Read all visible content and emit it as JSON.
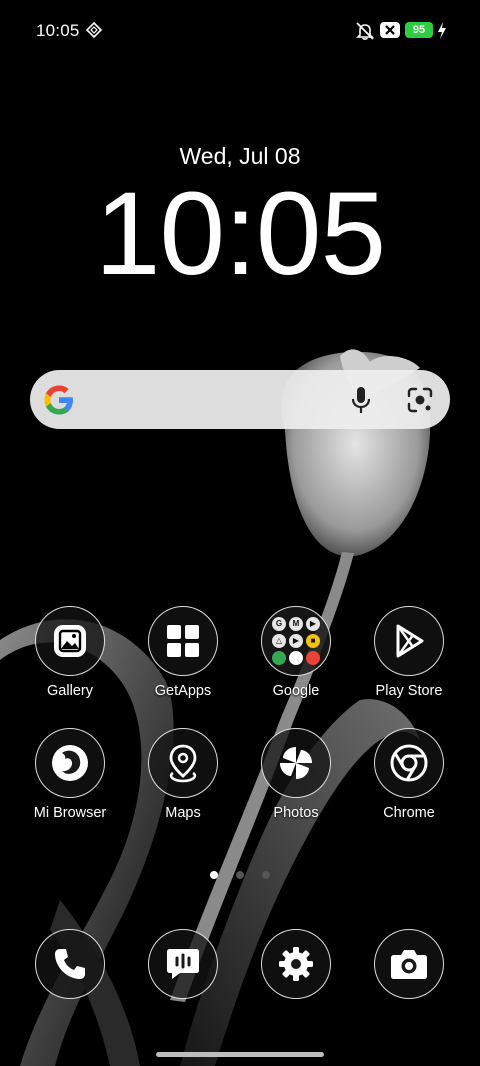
{
  "status_bar": {
    "time": "10:05",
    "battery": "95",
    "icons": [
      "network-diamond-icon",
      "mute-icon",
      "x-notification-icon",
      "charging-bolt-icon"
    ],
    "battery_color": "#2ecc40"
  },
  "clock": {
    "date": "Wed, Jul 08",
    "time": "10:05"
  },
  "search": {
    "icons": [
      "google-logo-icon",
      "mic-icon",
      "lens-camera-icon"
    ]
  },
  "apps": [
    {
      "label": "Gallery",
      "icon": "gallery-icon"
    },
    {
      "label": "GetApps",
      "icon": "getapps-grid-icon"
    },
    {
      "label": "Google",
      "icon": "google-folder-icon"
    },
    {
      "label": "Play Store",
      "icon": "play-store-icon"
    },
    {
      "label": "Mi Browser",
      "icon": "mi-browser-icon"
    },
    {
      "label": "Maps",
      "icon": "maps-pin-icon"
    },
    {
      "label": "Photos",
      "icon": "photos-pinwheel-icon"
    },
    {
      "label": "Chrome",
      "icon": "chrome-icon"
    }
  ],
  "google_folder": {
    "mini_icons": [
      "G",
      "M",
      "▶",
      "△",
      "▶",
      "■",
      "●",
      "●",
      "●"
    ]
  },
  "dock": [
    {
      "icon": "phone-icon"
    },
    {
      "icon": "messages-icon"
    },
    {
      "icon": "settings-gear-icon"
    },
    {
      "icon": "camera-icon"
    }
  ],
  "page_indicator": {
    "pages": 3,
    "current": 1
  }
}
